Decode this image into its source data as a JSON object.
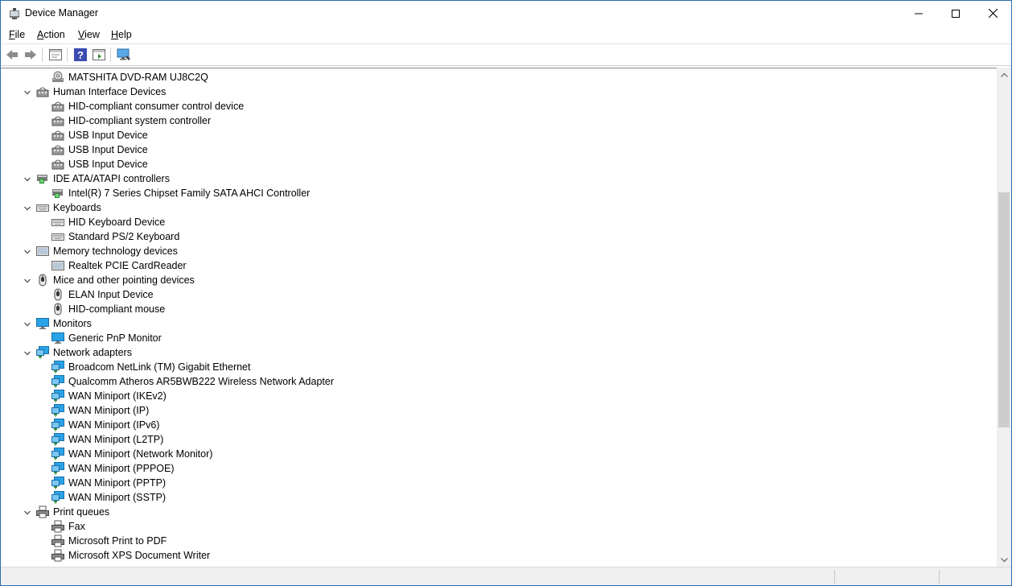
{
  "window": {
    "title": "Device Manager"
  },
  "menu": {
    "file": "File",
    "action": "Action",
    "view": "View",
    "help": "Help"
  },
  "toolbar": {
    "buttons": [
      "back-icon",
      "forward-icon",
      "properties-icon",
      "help-icon",
      "console-tree-icon",
      "monitor-scan-icon"
    ]
  },
  "tree": {
    "partial_top_item": "MATSHITA DVD-RAM UJ8C2Q",
    "categories": [
      {
        "label": "Human Interface Devices",
        "icon": "hid-icon",
        "items": [
          "HID-compliant consumer control device",
          "HID-compliant system controller",
          "USB Input Device",
          "USB Input Device",
          "USB Input Device"
        ]
      },
      {
        "label": "IDE ATA/ATAPI controllers",
        "icon": "ide-controller-icon",
        "items": [
          "Intel(R) 7 Series Chipset Family SATA AHCI Controller"
        ]
      },
      {
        "label": "Keyboards",
        "icon": "keyboard-icon",
        "items": [
          "HID Keyboard Device",
          "Standard PS/2 Keyboard"
        ]
      },
      {
        "label": "Memory technology devices",
        "icon": "memory-device-icon",
        "items": [
          "Realtek PCIE CardReader"
        ]
      },
      {
        "label": "Mice and other pointing devices",
        "icon": "mouse-icon",
        "items": [
          "ELAN Input Device",
          "HID-compliant mouse"
        ]
      },
      {
        "label": "Monitors",
        "icon": "monitor-icon",
        "items": [
          "Generic PnP Monitor"
        ]
      },
      {
        "label": "Network adapters",
        "icon": "network-adapter-icon",
        "items": [
          "Broadcom NetLink (TM) Gigabit Ethernet",
          "Qualcomm Atheros AR5BWB222 Wireless Network Adapter",
          "WAN Miniport (IKEv2)",
          "WAN Miniport (IP)",
          "WAN Miniport (IPv6)",
          "WAN Miniport (L2TP)",
          "WAN Miniport (Network Monitor)",
          "WAN Miniport (PPPOE)",
          "WAN Miniport (PPTP)",
          "WAN Miniport (SSTP)"
        ]
      },
      {
        "label": "Print queues",
        "icon": "printer-icon",
        "items": [
          "Fax",
          "Microsoft Print to PDF",
          "Microsoft XPS Document Writer"
        ]
      }
    ]
  },
  "colors": {
    "title_border": "#2b6fb1",
    "monitor_blue": "#1e90d8",
    "scroll_thumb": "#cdcdcd"
  }
}
